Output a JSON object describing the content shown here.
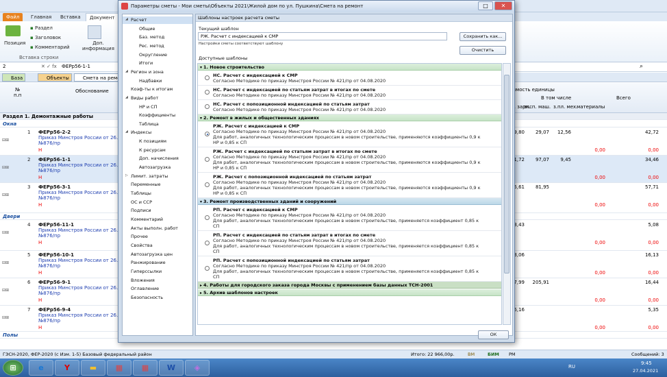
{
  "app": {
    "tabs": [
      "Файл",
      "Главная",
      "Вставка",
      "Документ"
    ],
    "ribbon": {
      "razdel": "Раздел",
      "zagolovok": "Заголовок",
      "kommentariy": "Комментарий",
      "pozitsiya": "Позиция",
      "dop_info": "Доп.\nинформация",
      "group": "Вставка строки"
    },
    "formula": {
      "cell": "2",
      "value": "ФЕРр56-1-1"
    },
    "bottom_tabs": [
      "База",
      "Объекты",
      "Смета на ремон"
    ],
    "grid_head": {
      "num": "№\nп.п",
      "obosn": "Обоснование",
      "stoimost": "тоимость единицы",
      "vtom": "В том числе",
      "vsego": "Всего",
      "c1": "осн. зарп.",
      "c2": "эксп. маш.",
      "c3": "з.пл. мех.",
      "c4": "материалы"
    },
    "section1": "Раздел 1. Демонтажные работы",
    "cat_okna": "Окна",
    "cat_dveri": "Двери",
    "cat_poly": "Полы",
    "rows": [
      {
        "n": "1",
        "code": "ФЕРр56-2-2",
        "src1": "Приказ Минстроя России от 26.12",
        "src2": "№876/пр",
        "h": "Н",
        "v1": "9,80",
        "v2": "29,07",
        "v3": "12,56",
        "v4": "42,72",
        "z1": "0,00",
        "z2": "0,00"
      },
      {
        "n": "2",
        "code": "ФЕРр56-1-1",
        "src1": "Приказ Минстроя России от 26.12",
        "src2": "№876/пр",
        "h": "Н",
        "v1": "1,72",
        "v2": "97,07",
        "v3": "9,45",
        "v4": "34,46",
        "z1": "0,00",
        "z2": "0,00"
      },
      {
        "n": "3",
        "code": "ФЕРр56-3-1",
        "src1": "Приказ Минстроя России от 26.12",
        "src2": "№876/пр",
        "h": "Н",
        "v1": "5,61",
        "v2": "81,95",
        "v3": "",
        "v4": "57,71",
        "z1": "0,00",
        "z2": "0,00"
      },
      {
        "n": "4",
        "code": "ФЕРр56-11-1",
        "src1": "Приказ Минстроя России от 26.12",
        "src2": "№876/пр",
        "h": "Н",
        "v1": "3,43",
        "v2": "",
        "v3": "",
        "v4": "5,08",
        "z1": "0,00",
        "z2": "0,00"
      },
      {
        "n": "5",
        "code": "ФЕРр56-10-1",
        "src1": "Приказ Минстроя России от 26.12",
        "src2": "№876/пр",
        "h": "Н",
        "v1": "3,06",
        "v2": "",
        "v3": "",
        "v4": "16,13",
        "z1": "0,00",
        "z2": "0,00"
      },
      {
        "n": "6",
        "code": "ФЕРр56-9-1",
        "src1": "Приказ Минстроя России от 26.12",
        "src2": "№876/пр",
        "h": "Н",
        "v1": "7,99",
        "v2": "205,91",
        "v3": "",
        "v4": "16,44",
        "z1": "0,00",
        "z2": "0,00"
      },
      {
        "n": "7",
        "code": "ФЕРр56-9-4",
        "src1": "Приказ Минстроя России от 26.12",
        "src2": "№876/пр",
        "h": "Н",
        "v1": "5,16",
        "v2": "",
        "v3": "",
        "v4": "5,35",
        "z1": "0,00",
        "z2": "0,00"
      }
    ],
    "status": {
      "left": "ГЭСН-2020, ФЕР-2020 (с Изм. 1-5)   Базовый федеральный район",
      "itogo": "Итого: 22 966,00р.",
      "vm": "ВМ",
      "bim": "БИМ",
      "rm": "РМ",
      "msgs": "Сообщений: 3"
    },
    "tray": {
      "lang": "RU",
      "time": "9:45",
      "date": "27.04.2021"
    }
  },
  "dialog": {
    "title": "Параметры сметы - Мои сметы\\Объекты 2021\\Жилой дом по ул. Пушкина\\Смета на ремонт",
    "panel_title": "Шаблоны настроек расчета сметы",
    "current_label": "Текущий шаблон",
    "current_value": "РЖ. Расчет с индексацией к СМР",
    "hint": "Настройки сметы соответствуют шаблону",
    "save_btn": "Сохранить как...",
    "clear_btn": "Очистить",
    "available_label": "Доступные шаблоны",
    "ok_btn": "ОК",
    "tree": [
      {
        "label": "Расчет",
        "lvl": 0,
        "exp": true,
        "sel": true
      },
      {
        "label": "Общие",
        "lvl": 1
      },
      {
        "label": "Баз. метод",
        "lvl": 1
      },
      {
        "label": "Рес. метод",
        "lvl": 1
      },
      {
        "label": "Округление",
        "lvl": 1
      },
      {
        "label": "Итоги",
        "lvl": 1
      },
      {
        "label": "Регион и зона",
        "lvl": 0,
        "exp": true
      },
      {
        "label": "Надбавки",
        "lvl": 1
      },
      {
        "label": "Коэф-ты к итогам",
        "lvl": 0
      },
      {
        "label": "Виды работ",
        "lvl": 0,
        "exp": true
      },
      {
        "label": "НР и СП",
        "lvl": 1
      },
      {
        "label": "Коэффициенты",
        "lvl": 1
      },
      {
        "label": "Таблица",
        "lvl": 1
      },
      {
        "label": "Индексы",
        "lvl": 0,
        "exp": true
      },
      {
        "label": "К позициям",
        "lvl": 1
      },
      {
        "label": "К ресурсам",
        "lvl": 1
      },
      {
        "label": "Доп. начисления",
        "lvl": 1
      },
      {
        "label": "Автозагрузка",
        "lvl": 1
      },
      {
        "label": "Лимит. затраты",
        "lvl": 0,
        "col": true
      },
      {
        "label": "Переменные",
        "lvl": 0
      },
      {
        "label": "Таблицы",
        "lvl": 0
      },
      {
        "label": "ОС и ССР",
        "lvl": 0
      },
      {
        "label": "Подписи",
        "lvl": 0
      },
      {
        "label": "Комментарий",
        "lvl": 0
      },
      {
        "label": "Акты выполн. работ",
        "lvl": 0
      },
      {
        "label": "Прочее",
        "lvl": 0
      },
      {
        "label": "Свойства",
        "lvl": 0
      },
      {
        "label": "Автозагрузка цен",
        "lvl": 0
      },
      {
        "label": "Ранжирование",
        "lvl": 0
      },
      {
        "label": "Гиперссылки",
        "lvl": 0
      },
      {
        "label": "Вложения",
        "lvl": 0
      },
      {
        "label": "Оглавление",
        "lvl": 0
      },
      {
        "label": "Безопасность",
        "lvl": 0
      }
    ],
    "groups": [
      {
        "title": "1. Новое строительство",
        "style": "g",
        "items": [
          {
            "t": "НС. Расчет с индексацией к СМР",
            "d": [
              "Согласно Методике по приказу Минстроя России № 421/пр от 04.08.2020"
            ]
          },
          {
            "t": "НС. Расчет с индексацией по статьям затрат в итогах по смете",
            "d": [
              "Согласно Методике по приказу Минстроя России № 421/пр от 04.08.2020"
            ]
          },
          {
            "t": "НС. Расчет с попозиционной индексацией по статьям затрат",
            "d": [
              "Согласно Методике по приказу Минстроя России № 421/пр от 04.08.2020"
            ]
          }
        ]
      },
      {
        "title": "2. Ремонт в жилых и общественных зданиях",
        "style": "g",
        "items": [
          {
            "t": "РЖ. Расчет с индексацией к СМР",
            "sel": true,
            "d": [
              "Согласно Методике по приказу Минстроя России № 421/пр от 04.08.2020",
              "Для работ, аналогичных технологическим процессам в новом строительстве, применяются коэффициенты 0,9 к",
              "НР и 0,85 к СП"
            ]
          },
          {
            "t": "РЖ. Расчет с индексацией по статьям затрат в итогах по смете",
            "d": [
              "Согласно Методике по приказу Минстроя России № 421/пр от 04.08.2020",
              "Для работ, аналогичных технологическим процессам в новом строительстве, применяются коэффициенты 0,9 к",
              "НР и 0,85 к СП"
            ]
          },
          {
            "t": "РЖ. Расчет с попозиционной индексацией по статьям затрат",
            "d": [
              "Согласно Методике по приказу Минстроя России № 421/пр от 04.08.2020",
              "Для работ, аналогичных технологическим процессам в новом строительстве, применяются коэффициенты 0,9 к",
              "НР и 0,85 к СП"
            ]
          }
        ]
      },
      {
        "title": "3. Ремонт производственных зданий и сооружений",
        "style": "b",
        "items": [
          {
            "t": "РП. Расчет с индексацией к СМР",
            "d": [
              "Согласно Методике по приказу Минстроя России № 421/пр от 04.08.2020",
              "Для работ, аналогичных технологическим процессам в новом строительстве, применяется коэффициент 0,85 к",
              "СП"
            ]
          },
          {
            "t": "РП. Расчет с индексацией по статьям затрат в итогах по смете",
            "d": [
              "Согласно Методике по приказу Минстроя России № 421/пр от 04.08.2020",
              "Для работ, аналогичных технологическим процессам в новом строительстве, применяется коэффициент 0,85 к",
              "СП"
            ]
          },
          {
            "t": "РП. Расчет с попозиционной индексацией по статьям затрат",
            "d": [
              "Согласно Методике по приказу Минстроя России № 421/пр от 04.08.2020",
              "Для работ, аналогичных технологическим процессам в новом строительстве, применяется коэффициент 0,85 к",
              "СП"
            ]
          }
        ]
      },
      {
        "title": "4. Работы для городского заказа города Москвы с применением базы данных ТСН-2001",
        "style": "c",
        "items": []
      },
      {
        "title": "5. Архив шаблонов настроек",
        "style": "g",
        "items": []
      }
    ]
  }
}
